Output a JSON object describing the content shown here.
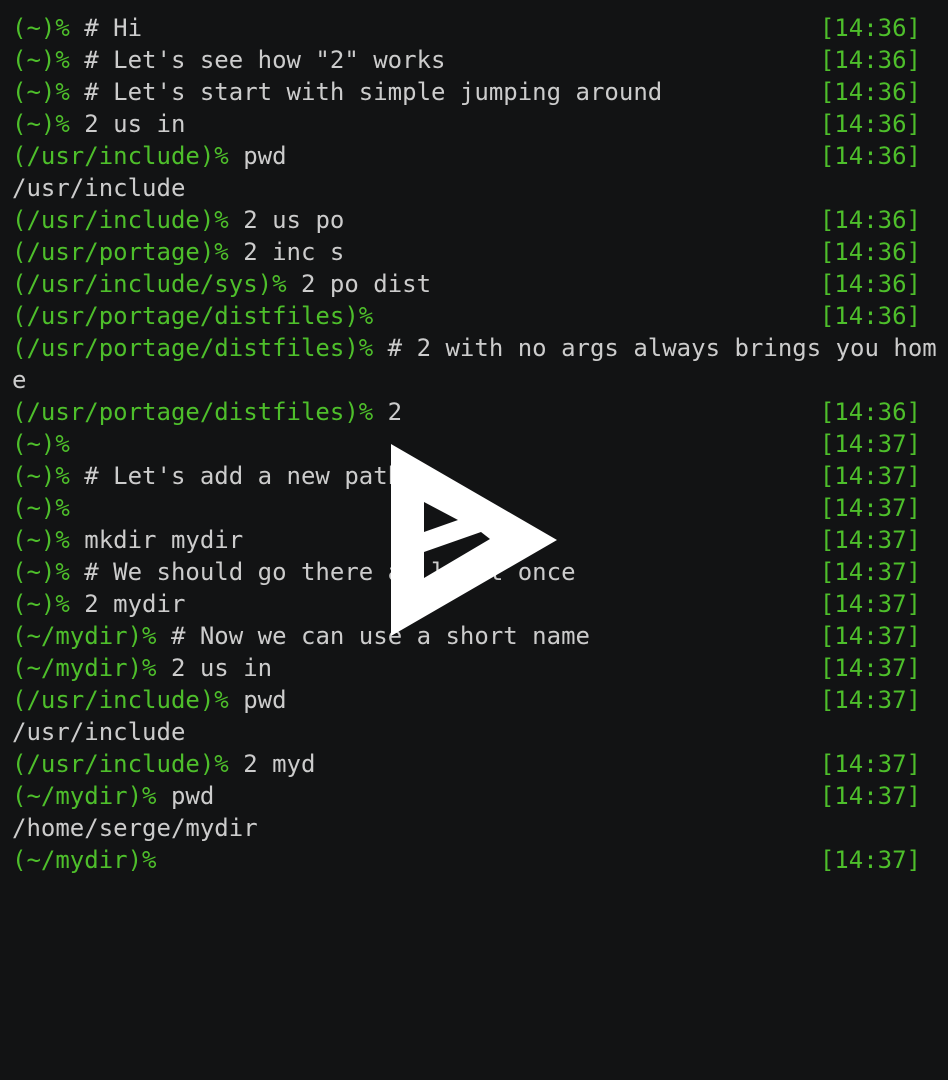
{
  "terminal": {
    "lines": [
      {
        "type": "prompt",
        "prompt": "(~)%",
        "cmd": " # Hi",
        "time": "[14:36]"
      },
      {
        "type": "prompt",
        "prompt": "(~)%",
        "cmd": " # Let's see how \"2\" works",
        "time": "[14:36]"
      },
      {
        "type": "prompt",
        "prompt": "(~)%",
        "cmd": " # Let's start with simple jumping around",
        "time": "[14:36]"
      },
      {
        "type": "prompt",
        "prompt": "(~)%",
        "cmd": " 2 us in",
        "time": "[14:36]"
      },
      {
        "type": "prompt",
        "prompt": "(/usr/include)%",
        "cmd": " pwd",
        "time": "[14:36]"
      },
      {
        "type": "output",
        "text": "/usr/include"
      },
      {
        "type": "prompt",
        "prompt": "(/usr/include)%",
        "cmd": " 2 us po",
        "time": "[14:36]"
      },
      {
        "type": "prompt",
        "prompt": "(/usr/portage)%",
        "cmd": " 2 inc s",
        "time": "[14:36]"
      },
      {
        "type": "prompt",
        "prompt": "(/usr/include/sys)%",
        "cmd": " 2 po dist",
        "time": "[14:36]"
      },
      {
        "type": "prompt",
        "prompt": "(/usr/portage/distfiles)%",
        "cmd": "",
        "time": "[14:36]"
      },
      {
        "type": "prompt",
        "prompt": "(/usr/portage/distfiles)%",
        "cmd": " # 2 with no args always brings you hom",
        "time": ""
      },
      {
        "type": "output",
        "text": "e"
      },
      {
        "type": "prompt",
        "prompt": "(/usr/portage/distfiles)%",
        "cmd": " 2",
        "time": "[14:36]"
      },
      {
        "type": "prompt",
        "prompt": "(~)%",
        "cmd": "",
        "time": "[14:37]"
      },
      {
        "type": "prompt",
        "prompt": "(~)%",
        "cmd": " # Let's add a new path",
        "time": "[14:37]"
      },
      {
        "type": "prompt",
        "prompt": "(~)%",
        "cmd": "",
        "time": "[14:37]"
      },
      {
        "type": "prompt",
        "prompt": "(~)%",
        "cmd": " mkdir mydir",
        "time": "[14:37]"
      },
      {
        "type": "prompt",
        "prompt": "(~)%",
        "cmd": " # We should go there at least once",
        "time": "[14:37]"
      },
      {
        "type": "prompt",
        "prompt": "(~)%",
        "cmd": " 2 mydir",
        "time": "[14:37]"
      },
      {
        "type": "prompt",
        "prompt": "(~/mydir)%",
        "cmd": " # Now we can use a short name",
        "time": "[14:37]"
      },
      {
        "type": "prompt",
        "prompt": "(~/mydir)%",
        "cmd": " 2 us in",
        "time": "[14:37]"
      },
      {
        "type": "prompt",
        "prompt": "(/usr/include)%",
        "cmd": " pwd",
        "time": "[14:37]"
      },
      {
        "type": "output",
        "text": "/usr/include"
      },
      {
        "type": "prompt",
        "prompt": "(/usr/include)%",
        "cmd": " 2 myd",
        "time": "[14:37]"
      },
      {
        "type": "prompt",
        "prompt": "(~/mydir)%",
        "cmd": " pwd",
        "time": "[14:37]"
      },
      {
        "type": "output",
        "text": "/home/serge/mydir"
      },
      {
        "type": "prompt",
        "prompt": "(~/mydir)%",
        "cmd": "",
        "time": "[14:37]"
      }
    ]
  },
  "overlay": {
    "icon": "play-icon",
    "color": "#ffffff"
  },
  "colors": {
    "background": "#121314",
    "prompt": "#4ebf2b",
    "text": "#cccccc"
  }
}
